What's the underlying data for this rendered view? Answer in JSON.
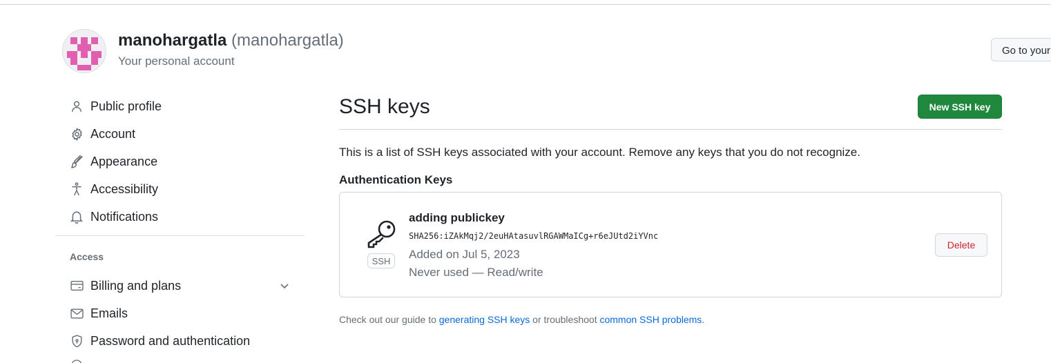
{
  "header": {
    "display_name": "manohargatla",
    "login": "(manohargatla)",
    "subtitle": "Your personal account",
    "go_to_profile_label": "Go to your"
  },
  "sidebar": {
    "items": [
      {
        "label": "Public profile",
        "icon": "person-icon"
      },
      {
        "label": "Account",
        "icon": "gear-icon"
      },
      {
        "label": "Appearance",
        "icon": "paintbrush-icon"
      },
      {
        "label": "Accessibility",
        "icon": "accessibility-icon"
      },
      {
        "label": "Notifications",
        "icon": "bell-icon"
      }
    ],
    "access_heading": "Access",
    "access_items": [
      {
        "label": "Billing and plans",
        "icon": "credit-card-icon"
      },
      {
        "label": "Emails",
        "icon": "mail-icon"
      },
      {
        "label": "Password and authentication",
        "icon": "shield-lock-icon"
      }
    ]
  },
  "main": {
    "title": "SSH keys",
    "new_key_label": "New SSH key",
    "intro": "This is a list of SSH keys associated with your account. Remove any keys that you do not recognize.",
    "auth_heading": "Authentication Keys",
    "keys": [
      {
        "title": "adding publickey",
        "fingerprint": "SHA256:iZAkMqj2/2euHAtasuvlRGAWMaICg+r6eJUtd2iYVnc",
        "added": "Added on Jul 5, 2023",
        "usage": "Never used — Read/write",
        "badge": "SSH",
        "delete_label": "Delete"
      }
    ],
    "footer": {
      "prefix": "Check out our guide to ",
      "link1": "generating SSH keys",
      "middle": " or troubleshoot ",
      "link2": "common SSH problems",
      "suffix": "."
    }
  },
  "colors": {
    "primary_button": "#1f883d",
    "danger_text": "#cf222e",
    "link": "#0969da",
    "muted": "#656d76",
    "avatar_pink": "#e25fb0"
  }
}
